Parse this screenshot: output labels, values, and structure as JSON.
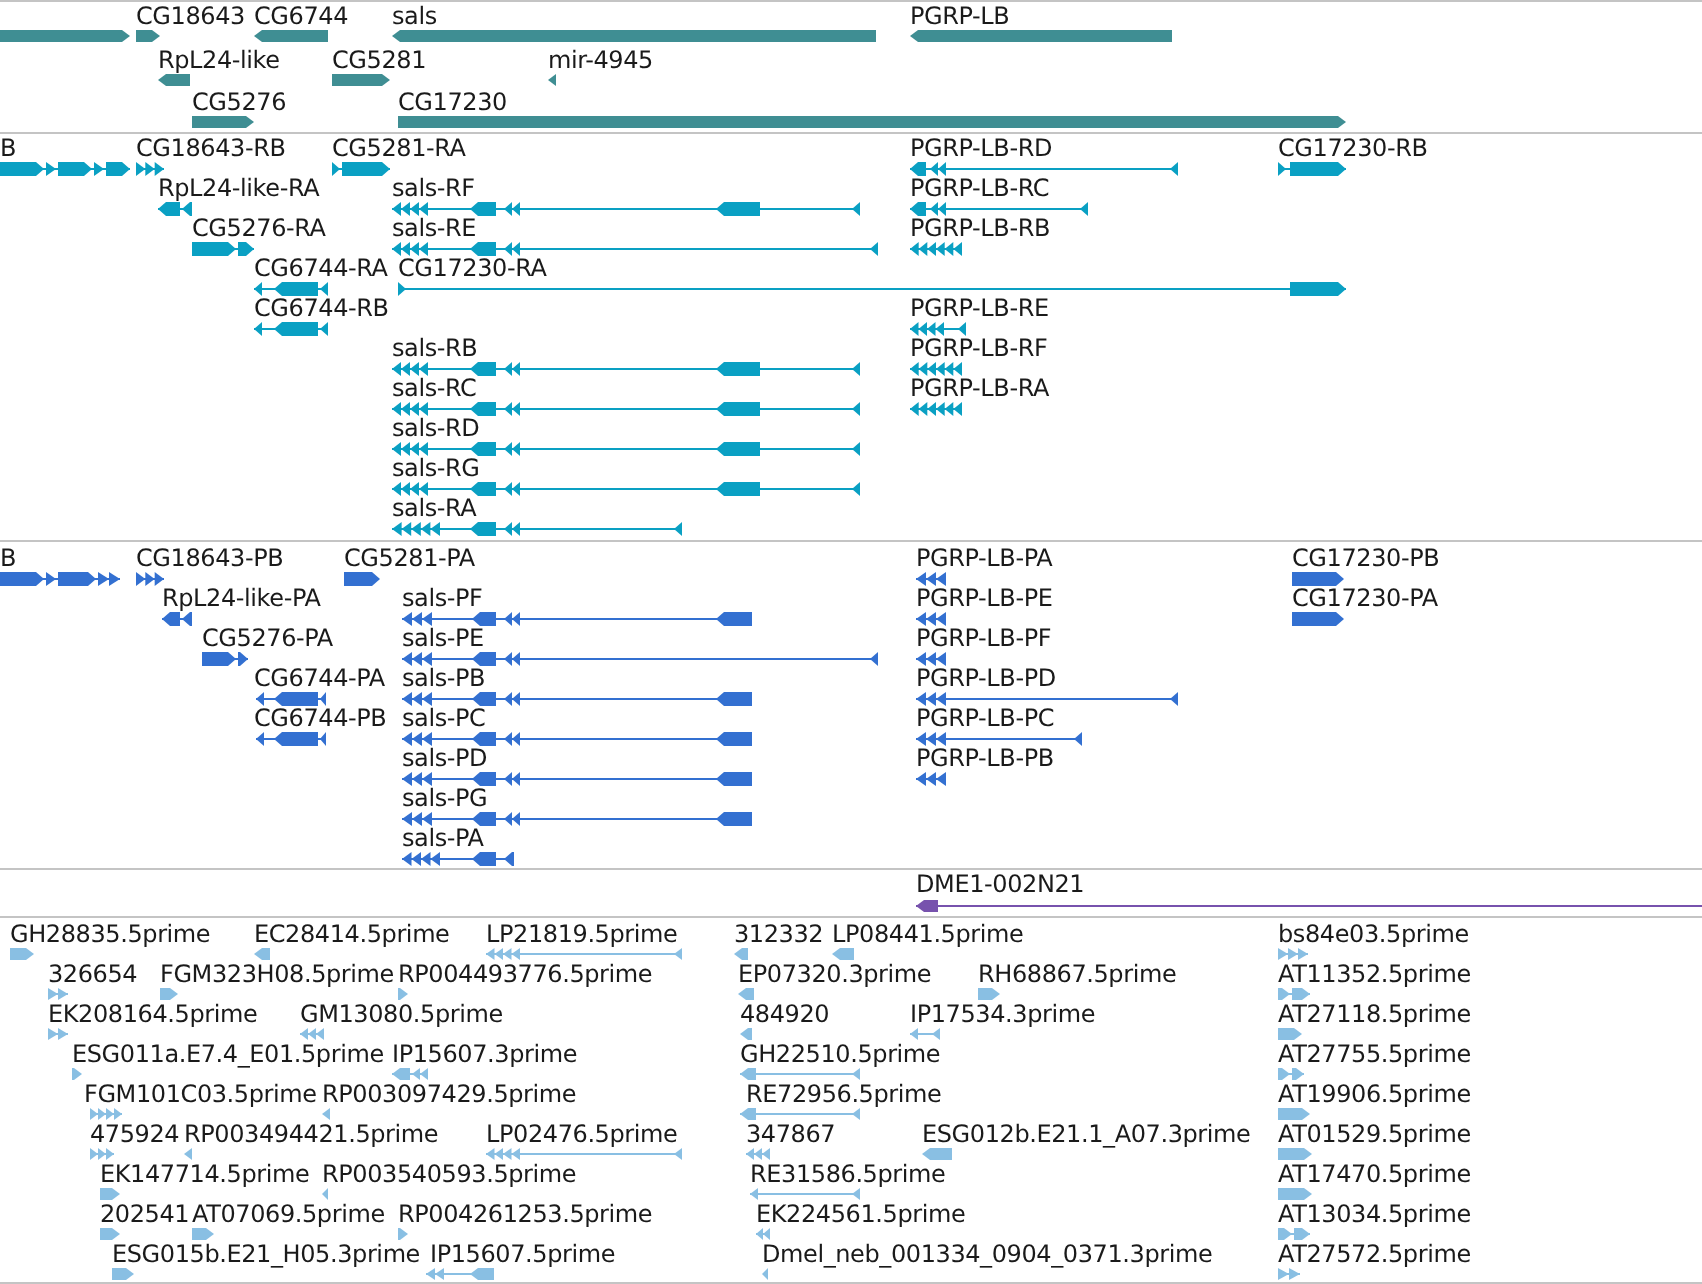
{
  "tracks": [
    {
      "kind": "gene",
      "features": [
        {
          "reverse": false
        },
        {
          "label": "CG18643",
          "reverse": false
        },
        {
          "label": "CG6744",
          "reverse": true
        },
        {
          "label": "sals",
          "reverse": true
        },
        {
          "label": "PGRP-LB",
          "reverse": true
        },
        {
          "label": "RpL24-like",
          "reverse": true
        },
        {
          "label": "CG5281",
          "reverse": false
        },
        {
          "label": "mir-4945",
          "reverse": true
        },
        {
          "label": "CG5276",
          "reverse": false
        },
        {
          "label": "CG17230",
          "reverse": false
        }
      ]
    },
    {
      "kind": "transcript",
      "features": [
        {
          "label": "B",
          "reverse": false
        },
        {
          "label": "CG18643-RB",
          "reverse": false
        },
        {
          "label": "CG5281-RA",
          "reverse": false
        },
        {
          "label": "PGRP-LB-RD",
          "reverse": true
        },
        {
          "label": "CG17230-RB",
          "reverse": false
        },
        {
          "label": "RpL24-like-RA",
          "reverse": true
        },
        {
          "label": "sals-RF",
          "reverse": true
        },
        {
          "label": "PGRP-LB-RC",
          "reverse": true
        },
        {
          "label": "CG5276-RA",
          "reverse": false
        },
        {
          "label": "sals-RE",
          "reverse": true
        },
        {
          "label": "PGRP-LB-RB",
          "reverse": true
        },
        {
          "label": "CG6744-RA",
          "reverse": true
        },
        {
          "label": "CG17230-RA",
          "reverse": false
        },
        {
          "label": "CG6744-RB",
          "reverse": true
        },
        {
          "label": "PGRP-LB-RE",
          "reverse": true
        },
        {
          "label": "sals-RB",
          "reverse": true
        },
        {
          "label": "PGRP-LB-RF",
          "reverse": true
        },
        {
          "label": "sals-RC",
          "reverse": true
        },
        {
          "label": "PGRP-LB-RA",
          "reverse": true
        },
        {
          "label": "sals-RD",
          "reverse": true
        },
        {
          "label": "sals-RG",
          "reverse": true
        },
        {
          "label": "sals-RA",
          "reverse": true
        }
      ]
    },
    {
      "kind": "protein",
      "features": [
        {
          "label": "B",
          "reverse": false
        },
        {
          "label": "CG18643-PB",
          "reverse": false
        },
        {
          "label": "CG5281-PA",
          "reverse": false
        },
        {
          "label": "PGRP-LB-PA",
          "reverse": true
        },
        {
          "label": "CG17230-PB",
          "reverse": false
        },
        {
          "label": "RpL24-like-PA",
          "reverse": true
        },
        {
          "label": "sals-PF",
          "reverse": true
        },
        {
          "label": "PGRP-LB-PE",
          "reverse": true
        },
        {
          "label": "CG17230-PA",
          "reverse": false
        },
        {
          "label": "CG5276-PA",
          "reverse": false
        },
        {
          "label": "sals-PE",
          "reverse": true
        },
        {
          "label": "PGRP-LB-PF",
          "reverse": true
        },
        {
          "label": "CG6744-PA",
          "reverse": true
        },
        {
          "label": "sals-PB",
          "reverse": true
        },
        {
          "label": "PGRP-LB-PD",
          "reverse": true
        },
        {
          "label": "CG6744-PB",
          "reverse": true
        },
        {
          "label": "sals-PC",
          "reverse": true
        },
        {
          "label": "PGRP-LB-PC",
          "reverse": true
        },
        {
          "label": "sals-PD",
          "reverse": true
        },
        {
          "label": "PGRP-LB-PB",
          "reverse": true
        },
        {
          "label": "sals-PG",
          "reverse": true
        },
        {
          "label": "sals-PA",
          "reverse": true
        }
      ]
    },
    {
      "kind": "clone",
      "features": [
        {
          "label": "DME1-002N21",
          "reverse": true
        }
      ]
    },
    {
      "kind": "est",
      "features": [
        {
          "label": "GH28835.5prime",
          "reverse": false
        },
        {
          "label": "EC28414.5prime",
          "reverse": true
        },
        {
          "label": "LP21819.5prime",
          "reverse": true
        },
        {
          "label": "312332",
          "reverse": true
        },
        {
          "label": "LP08441.5prime",
          "reverse": true
        },
        {
          "label": "bs84e03.5prime",
          "reverse": false
        },
        {
          "label": "326654",
          "reverse": false
        },
        {
          "label": "FGM323H08.5prime",
          "reverse": false
        },
        {
          "label": "RP004493776.5prime",
          "reverse": false
        },
        {
          "label": "EP07320.3prime",
          "reverse": true
        },
        {
          "label": "RH68867.5prime",
          "reverse": false
        },
        {
          "label": "AT11352.5prime",
          "reverse": false
        },
        {
          "label": "EK208164.5prime",
          "reverse": false
        },
        {
          "label": "GM13080.5prime",
          "reverse": true
        },
        {
          "label": "484920",
          "reverse": true
        },
        {
          "label": "IP17534.3prime",
          "reverse": true
        },
        {
          "label": "AT27118.5prime",
          "reverse": false
        },
        {
          "label": "ESG011a.E7.4_E01.5prime",
          "reverse": false
        },
        {
          "label": "IP15607.3prime",
          "reverse": true
        },
        {
          "label": "GH22510.5prime",
          "reverse": true
        },
        {
          "label": "AT27755.5prime",
          "reverse": false
        },
        {
          "label": "FGM101C03.5prime",
          "reverse": false
        },
        {
          "label": "RP003097429.5prime",
          "reverse": true
        },
        {
          "label": "RE72956.5prime",
          "reverse": true
        },
        {
          "label": "AT19906.5prime",
          "reverse": false
        },
        {
          "label": "475924",
          "reverse": false
        },
        {
          "label": "RP003494421.5prime",
          "reverse": true
        },
        {
          "label": "LP02476.5prime",
          "reverse": true
        },
        {
          "label": "347867",
          "reverse": true
        },
        {
          "label": "ESG012b.E21.1_A07.3prime",
          "reverse": true
        },
        {
          "label": "AT01529.5prime",
          "reverse": false
        },
        {
          "label": "EK147714.5prime",
          "reverse": false
        },
        {
          "label": "RP003540593.5prime",
          "reverse": true
        },
        {
          "label": "RE31586.5prime",
          "reverse": true
        },
        {
          "label": "AT17470.5prime",
          "reverse": false
        },
        {
          "label": "202541",
          "reverse": false
        },
        {
          "label": "AT07069.5prime",
          "reverse": false
        },
        {
          "label": "RP004261253.5prime",
          "reverse": false
        },
        {
          "label": "EK224561.5prime",
          "reverse": true
        },
        {
          "label": "AT13034.5prime",
          "reverse": false
        },
        {
          "label": "ESG015b.E21_H05.3prime",
          "reverse": false
        },
        {
          "label": "IP15607.5prime",
          "reverse": true
        },
        {
          "label": "Dmel_neb_001334_0904_0371.3prime",
          "reverse": true
        },
        {
          "label": "AT27572.5prime",
          "reverse": false
        }
      ]
    }
  ]
}
